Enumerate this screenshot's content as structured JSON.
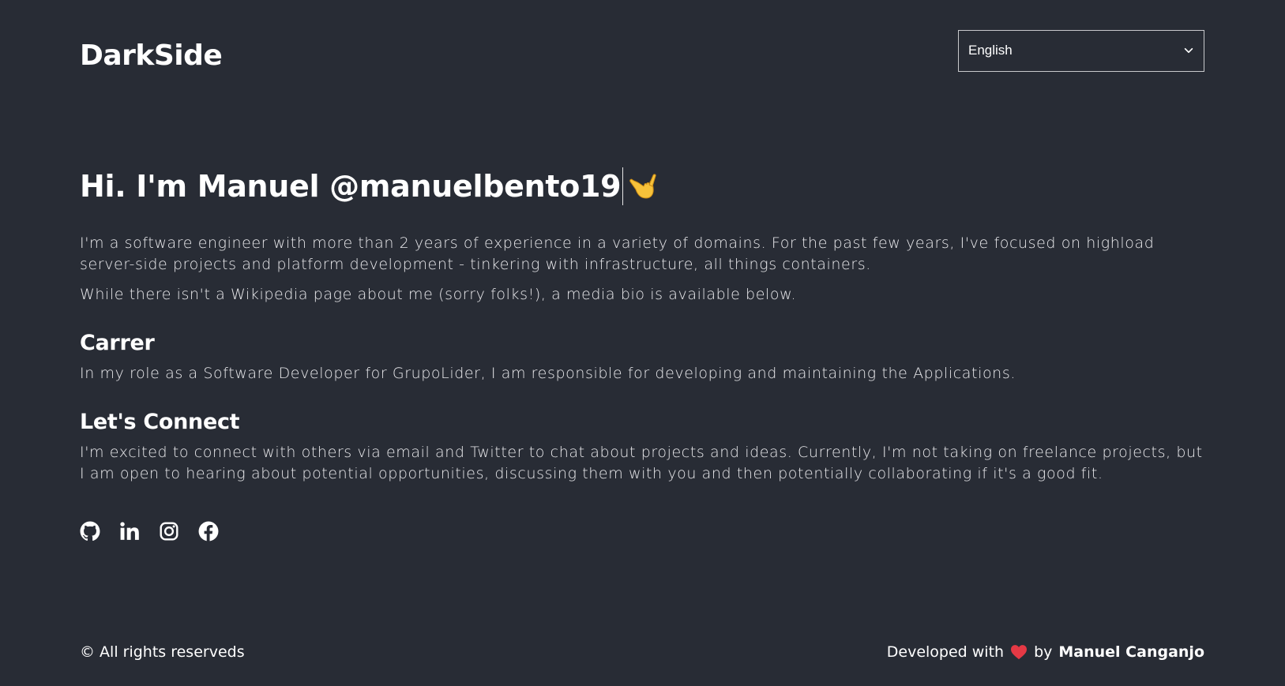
{
  "header": {
    "brand": "DarkSide",
    "language_select": {
      "value": "English"
    }
  },
  "hero": {
    "greeting": "Hi. I'm Manuel @manuelbento19",
    "emoji": "call-me-hand-emoji"
  },
  "intro": {
    "paragraph1": "I'm a software engineer with more than 2 years of experience in a variety of domains. For the past few years, I've focused on highload server-side projects and platform development - tinkering with infrastructure, all things containers.",
    "paragraph2": "While there isn't a Wikipedia page about me (sorry folks!), a media bio is available below."
  },
  "career": {
    "title": "Carrer",
    "text": "In my role as a Software Developer for GrupoLider, I am responsible for developing and maintaining the Applications."
  },
  "connect": {
    "title": "Let's Connect",
    "text": "I'm excited to connect with others via email and Twitter to chat about projects and ideas. Currently, I'm not taking on freelance projects, but I am open to hearing about potential opportunities, discussing them with you and then potentially collaborating if it's a good fit."
  },
  "socials": [
    {
      "icon": "github-icon"
    },
    {
      "icon": "linkedin-icon"
    },
    {
      "icon": "instagram-icon"
    },
    {
      "icon": "facebook-icon"
    }
  ],
  "footer": {
    "copyright": "© All rights reserveds",
    "developed_with": "Developed with",
    "by": "by",
    "author": "Manuel Canganjo"
  },
  "colors": {
    "background": "#282c35",
    "text": "#ffffff",
    "heart": "#e53945",
    "emoji": "#f7c23a"
  }
}
